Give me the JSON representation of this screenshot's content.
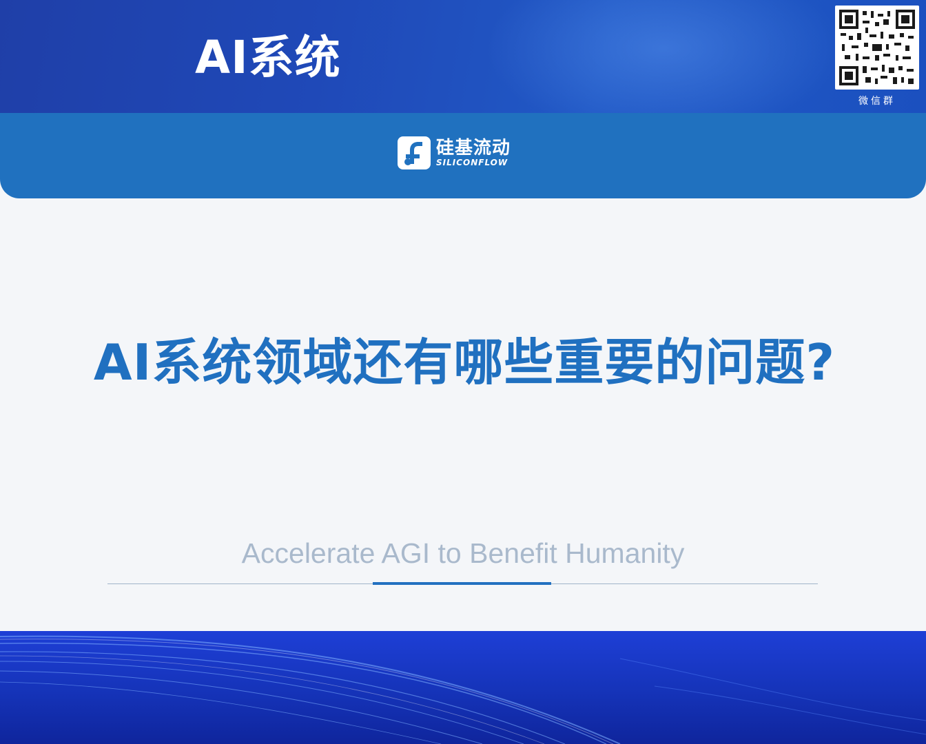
{
  "header": {
    "title": "AI系统",
    "qr_caption": "微信群"
  },
  "brand": {
    "name_cn": "硅基流动",
    "name_en": "SILICONFLOW"
  },
  "main": {
    "question": "AI系统领域还有哪些重要的问题?",
    "slogan": "Accelerate AGI to Benefit Humanity"
  },
  "colors": {
    "primary_blue": "#2070c0",
    "banner_blue": "#1f49b8",
    "slogan_gray": "#a9b9cc"
  }
}
